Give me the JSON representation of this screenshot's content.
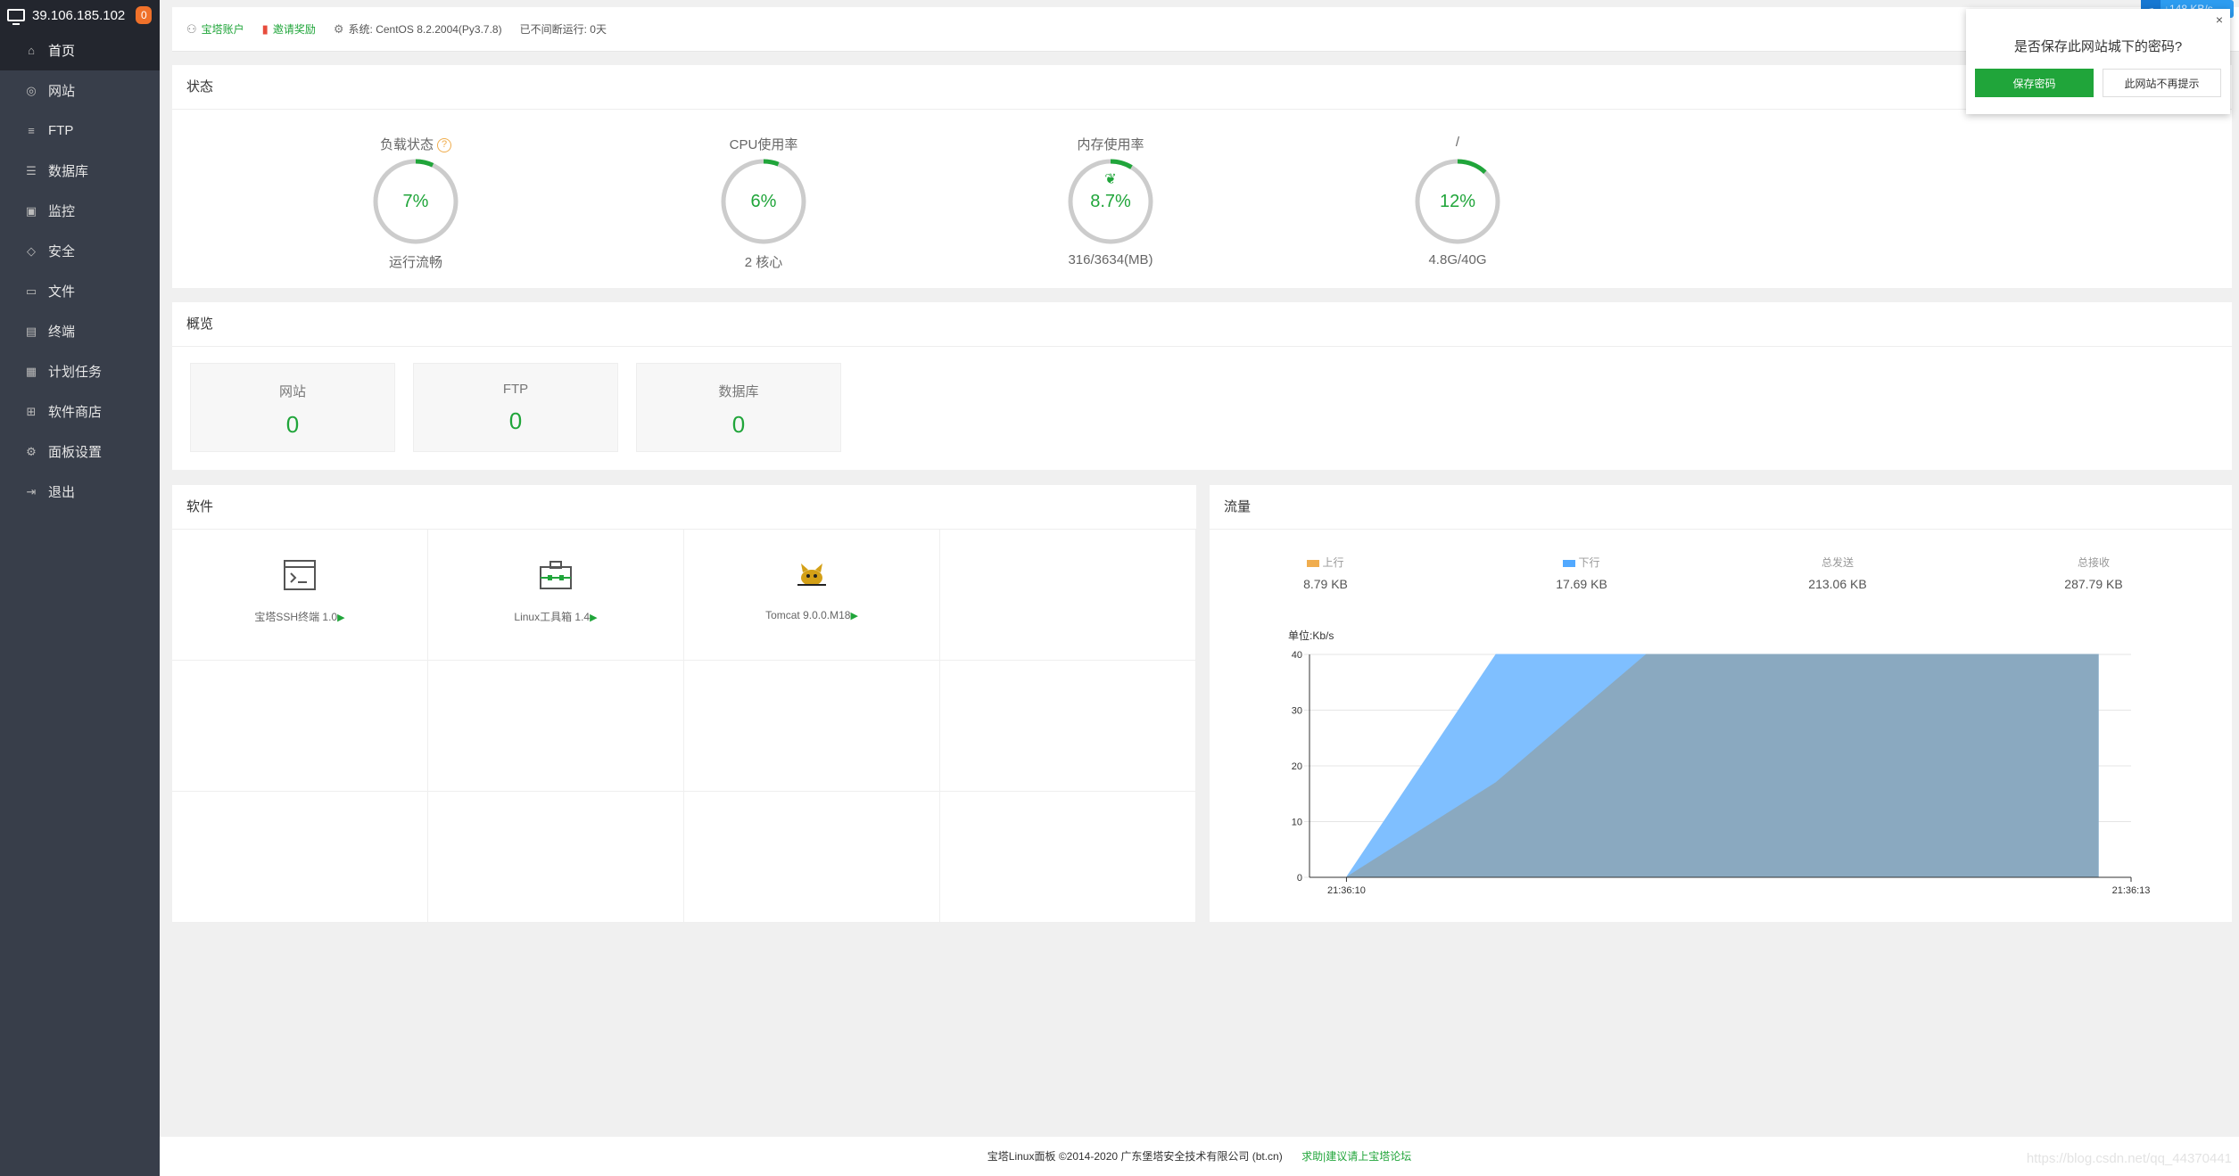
{
  "host": {
    "ip": "39.106.185.102",
    "badge": "0"
  },
  "nav": [
    {
      "label": "首页",
      "icon": "home-icon",
      "glyph": "⌂"
    },
    {
      "label": "网站",
      "icon": "globe-icon",
      "glyph": "◎"
    },
    {
      "label": "FTP",
      "icon": "ftp-icon",
      "glyph": "≡"
    },
    {
      "label": "数据库",
      "icon": "database-icon",
      "glyph": "☰"
    },
    {
      "label": "监控",
      "icon": "monitor-icon",
      "glyph": "▣"
    },
    {
      "label": "安全",
      "icon": "shield-icon",
      "glyph": "◇"
    },
    {
      "label": "文件",
      "icon": "folder-icon",
      "glyph": "▭"
    },
    {
      "label": "终端",
      "icon": "terminal-icon",
      "glyph": "▤"
    },
    {
      "label": "计划任务",
      "icon": "calendar-icon",
      "glyph": "▦"
    },
    {
      "label": "软件商店",
      "icon": "apps-icon",
      "glyph": "⊞"
    },
    {
      "label": "面板设置",
      "icon": "settings-icon",
      "glyph": "⚙"
    },
    {
      "label": "退出",
      "icon": "logout-icon",
      "glyph": "⇥"
    }
  ],
  "topbar": {
    "account": "宝塔账户",
    "invite": "邀请奖励",
    "system_label": "系统:",
    "system_value": "CentOS 8.2.2004(Py3.7.8)",
    "uptime": "已不间断运行: 0天"
  },
  "status": {
    "title": "状态",
    "gauges": [
      {
        "title": "负载状态",
        "value": "7%",
        "pct": 0.07,
        "sub": "运行流畅",
        "help": "?"
      },
      {
        "title": "CPU使用率",
        "value": "6%",
        "pct": 0.06,
        "sub": "2 核心"
      },
      {
        "title": "内存使用率",
        "value": "8.7%",
        "pct": 0.087,
        "sub": "316/3634(MB)",
        "leaf": true
      },
      {
        "title": "/",
        "value": "12%",
        "pct": 0.12,
        "sub": "4.8G/40G"
      }
    ],
    "accent": "#20a53a",
    "ring_track": "#cccccc"
  },
  "overview": {
    "title": "概览",
    "items": [
      {
        "label": "网站",
        "value": "0"
      },
      {
        "label": "FTP",
        "value": "0"
      },
      {
        "label": "数据库",
        "value": "0"
      }
    ]
  },
  "software": {
    "title": "软件",
    "items": [
      {
        "name": "宝塔SSH终端 1.0",
        "icon": "terminal-app-icon"
      },
      {
        "name": "Linux工具箱 1.4",
        "icon": "toolbox-icon"
      },
      {
        "name": "Tomcat 9.0.0.M18",
        "icon": "tomcat-icon"
      }
    ]
  },
  "traffic": {
    "title": "流量",
    "stats": [
      {
        "label": "上行",
        "value": "8.79 KB",
        "color": "#f0ad4e"
      },
      {
        "label": "下行",
        "value": "17.69 KB",
        "color": "#52a9ff"
      },
      {
        "label": "总发送",
        "value": "213.06 KB"
      },
      {
        "label": "总接收",
        "value": "287.79 KB"
      }
    ],
    "unit": "单位:Kb/s"
  },
  "chart_data": {
    "type": "area",
    "x": [
      "21:36:10",
      "21:36:10.2",
      "21:36:10.8",
      "21:36:11.3",
      "21:36:13",
      "21:36:13"
    ],
    "xticks": [
      "21:36:10",
      "21:36:13"
    ],
    "series": [
      {
        "name": "下行",
        "color": "#7fbfff",
        "values": [
          0,
          0,
          40,
          40,
          40,
          0
        ]
      },
      {
        "name": "上行",
        "color": "#8aa9c0",
        "values": [
          0,
          0,
          17,
          40,
          40,
          0
        ]
      }
    ],
    "ylim": [
      0,
      40
    ],
    "yticks": [
      0,
      10,
      20,
      30,
      40
    ],
    "ylabel": "单位:Kb/s",
    "grid": true
  },
  "popup": {
    "title": "是否保存此网站城下的密码?",
    "save": "保存密码",
    "never": "此网站不再提示",
    "close": "×"
  },
  "speed": {
    "rate": "↓148 KB/s"
  },
  "footer": {
    "copyright": "宝塔Linux面板 ©2014-2020 广东堡塔安全技术有限公司 (bt.cn)",
    "link": "求助|建议请上宝塔论坛"
  },
  "watermark": "https://blog.csdn.net/qq_44370441"
}
